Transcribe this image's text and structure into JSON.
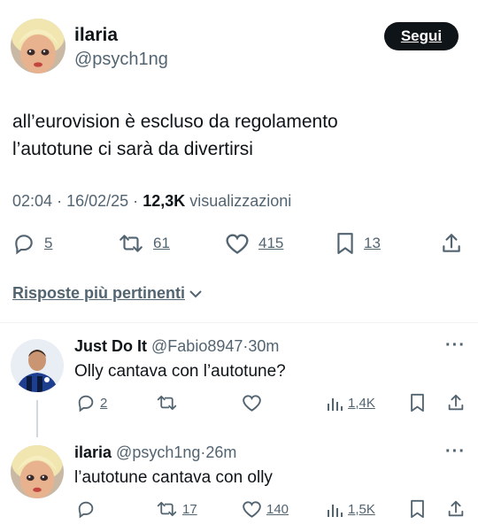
{
  "tweet": {
    "author_name": "ilaria",
    "author_handle": "@psych1ng",
    "follow_label": "Segui",
    "text_line1": "all’eurovision è escluso da regolamento",
    "text_line2": "l’autotune ci sarà da divertirsi",
    "time": "02:04",
    "date": "16/02/25",
    "views_count": "12,3K",
    "views_label": "visualizzazioni",
    "replies": "5",
    "retweets": "61",
    "likes": "415",
    "bookmarks": "13"
  },
  "sort_label": "Risposte più pertinenti",
  "replies": [
    {
      "name": "Just Do It",
      "handle": "@Fabio8947",
      "time": "30m",
      "text": "Olly cantava con l’autotune?",
      "replies": "2",
      "retweets": "",
      "likes": "",
      "views": "1,4K"
    },
    {
      "name": "ilaria",
      "handle": "@psych1ng",
      "time": "26m",
      "text": "l’autotune cantava con olly",
      "replies": "",
      "retweets": "17",
      "likes": "140",
      "views": "1,5K"
    }
  ],
  "separator": "·",
  "more_glyph": "···",
  "colors": {
    "text": "#0f1419",
    "muted": "#536471",
    "divider": "#eff3f4",
    "button_bg": "#0f1419"
  }
}
